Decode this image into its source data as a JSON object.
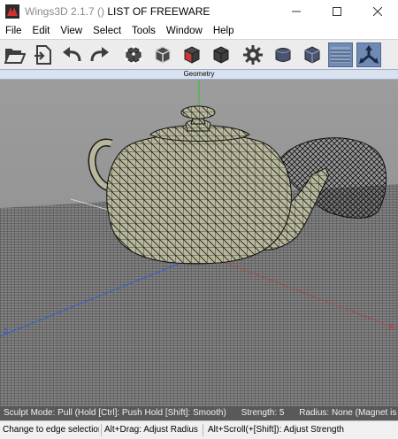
{
  "window": {
    "app_name": "Wings3D 2.1.7 ()",
    "document_title": "LIST OF FREEWARE"
  },
  "menu": [
    "File",
    "Edit",
    "View",
    "Select",
    "Tools",
    "Window",
    "Help"
  ],
  "toolbar": {
    "buttons": [
      {
        "name": "open-icon"
      },
      {
        "name": "import-icon"
      },
      {
        "name": "undo-icon"
      },
      {
        "name": "redo-icon"
      },
      {
        "name": "vertex-select-mode-icon"
      },
      {
        "name": "edge-select-mode-icon"
      },
      {
        "name": "face-select-mode-icon"
      },
      {
        "name": "body-select-mode-icon"
      },
      {
        "name": "settings-gear-icon"
      },
      {
        "name": "smooth-preview-icon"
      },
      {
        "name": "wireframe-toggle-icon"
      },
      {
        "name": "ground-plane-icon",
        "active": true
      },
      {
        "name": "axes-toggle-icon",
        "active": true
      }
    ]
  },
  "geometry_tab": "Geometry",
  "status": {
    "mode": "Sculpt Mode: Pull (Hold [Ctrl]: Push  Hold [Shift]: Smooth)",
    "strength": "Strength: 5",
    "radius": "Radius: None (Magnet is off)",
    "hint_select": "Change to edge selection mode",
    "hint_drag": "Alt+Drag: Adjust Radius",
    "hint_scroll": "Alt+Scroll(+[Shift]): Adjust Strength"
  },
  "colors": {
    "viewport_bg": "#8f8f8f",
    "ground_grid": "#4a4a4a",
    "teapot_fill": "#b9b89a",
    "mesh_lines": "#141414",
    "axis_x": "#c83030",
    "axis_y": "#2fc02f",
    "axis_z": "#2f5fd0"
  }
}
